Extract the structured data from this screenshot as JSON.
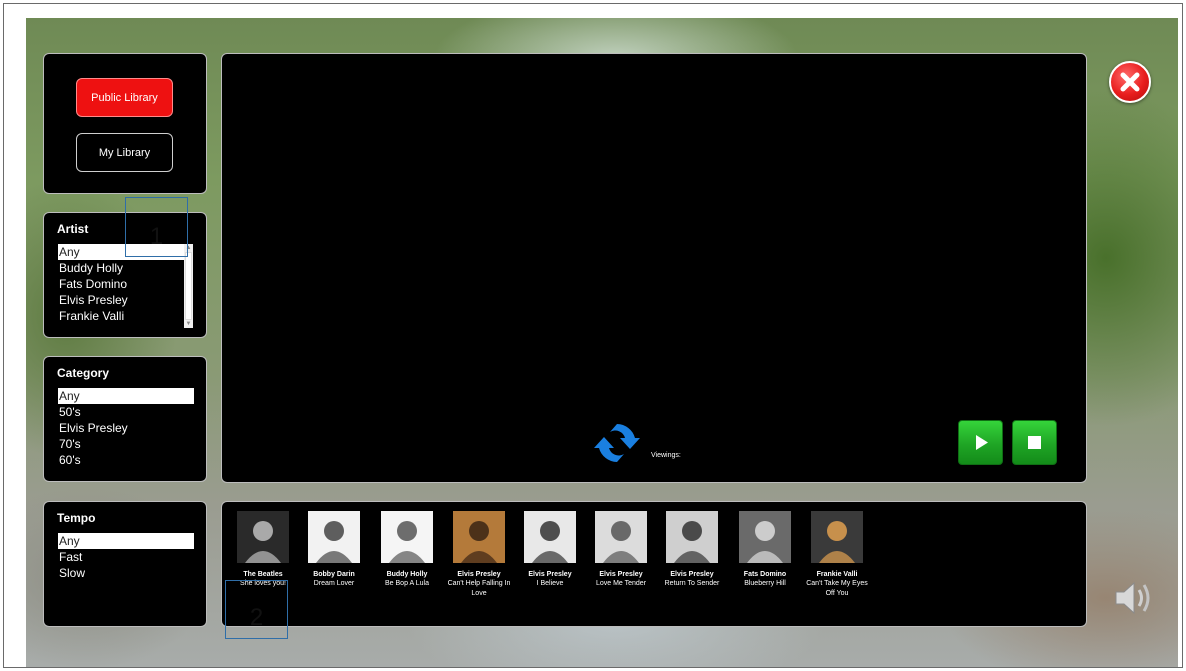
{
  "library": {
    "public_label": "Public Library",
    "my_label": "My Library"
  },
  "filters": {
    "artist": {
      "title": "Artist",
      "items": [
        "Any",
        "Buddy Holly",
        "Fats Domino",
        "Elvis Presley",
        "Frankie Valli"
      ],
      "selected": "Any"
    },
    "category": {
      "title": "Category",
      "items": [
        "Any",
        "50's",
        "Elvis Presley",
        "70's",
        "60's"
      ],
      "selected": "Any"
    },
    "tempo": {
      "title": "Tempo",
      "items": [
        "Any",
        "Fast",
        "Slow"
      ],
      "selected": "Any"
    }
  },
  "player": {
    "viewings_label": "Viewings:",
    "play_icon": "play-icon",
    "stop_icon": "stop-icon",
    "refresh_icon": "refresh-icon"
  },
  "songs": [
    {
      "artist": "The Beatles",
      "title": "She loves you!"
    },
    {
      "artist": "Bobby Darin",
      "title": "Dream Lover"
    },
    {
      "artist": "Buddy Holly",
      "title": "Be Bop A Lula"
    },
    {
      "artist": "Elvis Presley",
      "title": "Can't Help Falling In Love"
    },
    {
      "artist": "Elvis Presley",
      "title": "I Believe"
    },
    {
      "artist": "Elvis Presley",
      "title": "Love Me Tender"
    },
    {
      "artist": "Elvis Presley",
      "title": "Return To Sender"
    },
    {
      "artist": "Fats Domino",
      "title": "Blueberry Hill"
    },
    {
      "artist": "Frankie Valli",
      "title": "Can't Take My Eyes Off You"
    }
  ],
  "annotations": [
    "1",
    "2"
  ],
  "colors": {
    "accent_red": "#ee1111",
    "play_green": "#1fa525",
    "refresh_blue": "#1a7fe0"
  }
}
